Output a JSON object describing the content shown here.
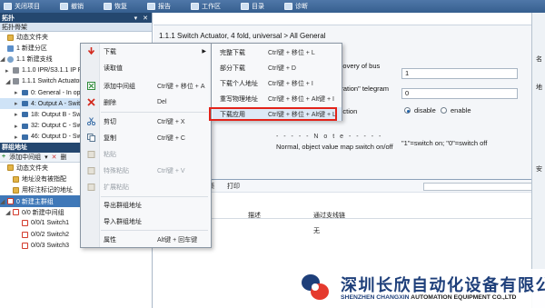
{
  "toolbar": {
    "items": [
      "关闭项目",
      "撤销",
      "恢复",
      "报告",
      "工作区",
      "目录",
      "诊断"
    ]
  },
  "topology_panel": {
    "title": "拓扑",
    "subheader": "拓扑骨架",
    "tree": [
      {
        "label": "动态文件夹"
      },
      {
        "label": "1 新建分区"
      },
      {
        "label": "1.1 新建支线"
      },
      {
        "label": "1.1.0 IPR/S3.1.1 IP Ro"
      },
      {
        "label": "1.1.1 Switch Actuator"
      },
      {
        "label": "0: General - In oper"
      },
      {
        "label": "4: Output A - Switch"
      },
      {
        "label": "18: Output B - Switc"
      },
      {
        "label": "32: Output C - Switc"
      },
      {
        "label": "46: Output D - Switc"
      }
    ]
  },
  "group_panel": {
    "title": "群组地址",
    "add_label": "添加中间组",
    "delete_label": "删",
    "tree": [
      {
        "label": "动态文件夹"
      },
      {
        "label": "地址没有被指配"
      },
      {
        "label": "用标注标记的地址"
      },
      {
        "label": "0 新建主群组"
      },
      {
        "label": "0/0 新建中间组"
      },
      {
        "label": "0/0/1 Switch1"
      },
      {
        "label": "0/0/2 Switch2"
      },
      {
        "label": "0/0/3 Switch3"
      }
    ]
  },
  "device_params": {
    "title": "1.1.1 Switch Actuator, 4 fold, universal > All General",
    "row1_label": "recovery of bus",
    "row1_value": "1",
    "row2_label": "peration\" telegram",
    "row2_value": "0",
    "row3_label": "function",
    "radio_options": [
      "disable",
      "enable"
    ],
    "radio_selected": "disable",
    "note_label": "- - - - - N o t e - - - - -",
    "note_text": "Normal, object value map switch on/off",
    "note_value": "\"1\"=switch on; \"0\"=switch off"
  },
  "bottom_pane": {
    "toolbar_items": [
      "帧",
      "打印"
    ],
    "columns": [
      "描述",
      "通过支线链"
    ],
    "empty_text": "无"
  },
  "right_strip": {
    "labels": [
      "名",
      "地",
      "安"
    ]
  },
  "context_menu": {
    "items": [
      {
        "label": "下载",
        "shortcut": "",
        "has_submenu": true,
        "disabled": false,
        "icon": "download-icon"
      },
      {
        "label": "读取值",
        "shortcut": "",
        "has_submenu": false,
        "disabled": false,
        "icon": ""
      },
      {
        "label": "添加中间组",
        "shortcut": "Ctrl键 + 移位 + A",
        "has_submenu": false,
        "disabled": false,
        "icon": "add-group-icon"
      },
      {
        "label": "删除",
        "shortcut": "Del",
        "has_submenu": false,
        "disabled": false,
        "icon": "delete-icon"
      },
      {
        "label": "剪切",
        "shortcut": "Ctrl键 + X",
        "has_submenu": false,
        "disabled": false,
        "icon": "cut-icon"
      },
      {
        "label": "复制",
        "shortcut": "Ctrl键 + C",
        "has_submenu": false,
        "disabled": false,
        "icon": "copy-icon"
      },
      {
        "label": "粘贴",
        "shortcut": "",
        "has_submenu": false,
        "disabled": true,
        "icon": "paste-icon"
      },
      {
        "label": "特殊粘贴",
        "shortcut": "Ctrl键 + V",
        "has_submenu": false,
        "disabled": true,
        "icon": "paste-special-icon"
      },
      {
        "label": "扩展粘贴",
        "shortcut": "",
        "has_submenu": false,
        "disabled": true,
        "icon": "paste-extended-icon"
      },
      {
        "label": "导出群组地址",
        "shortcut": "",
        "has_submenu": false,
        "disabled": false,
        "icon": ""
      },
      {
        "label": "导入群组地址",
        "shortcut": "",
        "has_submenu": false,
        "disabled": false,
        "icon": ""
      },
      {
        "label": "属性",
        "shortcut": "Alt键 + 回车键",
        "has_submenu": false,
        "disabled": false,
        "icon": ""
      }
    ]
  },
  "submenu": {
    "items": [
      {
        "label": "完整下载",
        "shortcut": "Ctrl键 + 移位 + L"
      },
      {
        "label": "部分下载",
        "shortcut": "Ctrl键 + D"
      },
      {
        "label": "下载个人地址",
        "shortcut": "Ctrl键 + 移位 + I"
      },
      {
        "label": "重写物理地址",
        "shortcut": "Ctrl键 + 移位 + Alt键 + I"
      },
      {
        "label": "下载应用",
        "shortcut": "Ctrl键 + 移位 + Alt键 + L"
      }
    ],
    "highlighted": "下载应用"
  },
  "watermark": {
    "company_cn": "深圳长欣自动化设备有限公司",
    "company_en_1": "SHENZHEN CHANGXIN ",
    "company_en_2": "AUTOMATION EQUIPMENT CO.,LTD",
    "logo_colors": [
      "#1e3f7a",
      "#e53a2e"
    ]
  }
}
